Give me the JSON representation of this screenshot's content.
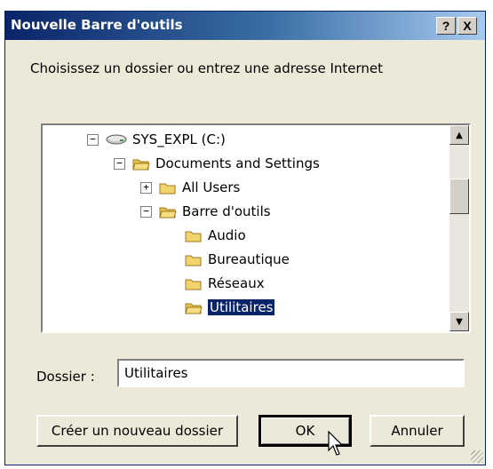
{
  "dialog": {
    "title": "Nouvelle Barre d'outils",
    "help_button": "?",
    "close_button": "X",
    "prompt": "Choisissez un dossier ou entrez une adresse Internet"
  },
  "tree": {
    "items": [
      {
        "label": "SYS_EXPL (C:)",
        "expander": "−",
        "icon": "drive-icon"
      },
      {
        "label": "Documents and Settings",
        "expander": "−",
        "icon": "folder-open-icon"
      },
      {
        "label": "All Users",
        "expander": "+",
        "icon": "folder-icon"
      },
      {
        "label": "Barre d'outils",
        "expander": "−",
        "icon": "folder-open-icon"
      },
      {
        "label": "Audio",
        "expander": "",
        "icon": "folder-icon"
      },
      {
        "label": "Bureautique",
        "expander": "",
        "icon": "folder-icon"
      },
      {
        "label": "Réseaux",
        "expander": "",
        "icon": "folder-icon"
      },
      {
        "label": "Utilitaires",
        "expander": "",
        "icon": "folder-icon",
        "selected": true
      }
    ],
    "scroll_up": "▲",
    "scroll_down": "▼"
  },
  "folder": {
    "label": "Dossier :",
    "value": "Utilitaires"
  },
  "buttons": {
    "new_folder": "Créer un nouveau dossier",
    "ok": "OK",
    "cancel": "Annuler"
  },
  "colors": {
    "title_start": "#0a246a",
    "title_end": "#a6caf0",
    "selection": "#0a246a",
    "folder": "#f3d36b"
  }
}
